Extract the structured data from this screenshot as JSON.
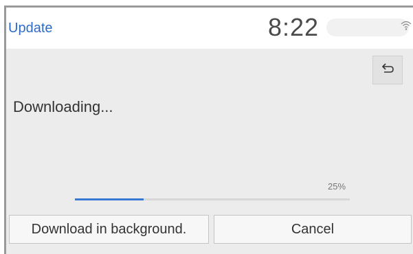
{
  "header": {
    "title": "Update",
    "time": "8:22"
  },
  "icons": {
    "wifi": "wifi-icon",
    "back": "back-arrow-icon"
  },
  "colors": {
    "title_blue": "#2f6bc4",
    "progress_blue": "#3a78d6"
  },
  "content": {
    "message": "Downloading...",
    "progress_percent_label": "25%",
    "progress_value": 0.25
  },
  "actions": {
    "background_label": "Download in background.",
    "cancel_label": "Cancel"
  }
}
